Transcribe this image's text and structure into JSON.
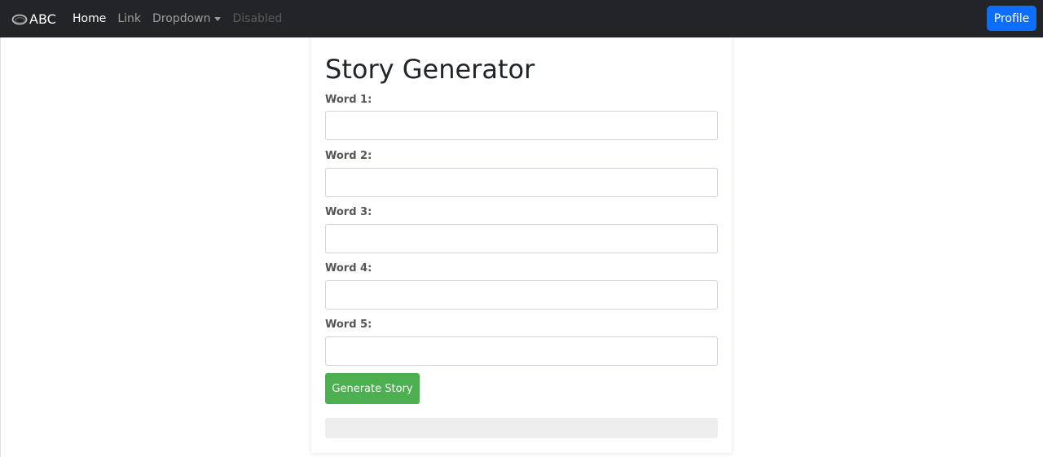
{
  "navbar": {
    "brand": "ABC",
    "brand_icon": "ring-logo-icon",
    "links": [
      {
        "label": "Home",
        "state": "active"
      },
      {
        "label": "Link",
        "state": "normal"
      },
      {
        "label": "Dropdown",
        "state": "dropdown"
      },
      {
        "label": "Disabled",
        "state": "disabled"
      }
    ],
    "profile_label": "Profile"
  },
  "form": {
    "title": "Story Generator",
    "fields": [
      {
        "label": "Word 1:",
        "value": ""
      },
      {
        "label": "Word 2:",
        "value": ""
      },
      {
        "label": "Word 3:",
        "value": ""
      },
      {
        "label": "Word 4:",
        "value": ""
      },
      {
        "label": "Word 5:",
        "value": ""
      }
    ],
    "submit_label": "Generate Story",
    "story_output": ""
  },
  "colors": {
    "navbar_bg": "#212529",
    "primary": "#0d6efd",
    "generate_button": "#4caf50",
    "output_bg": "#eeeeee"
  }
}
